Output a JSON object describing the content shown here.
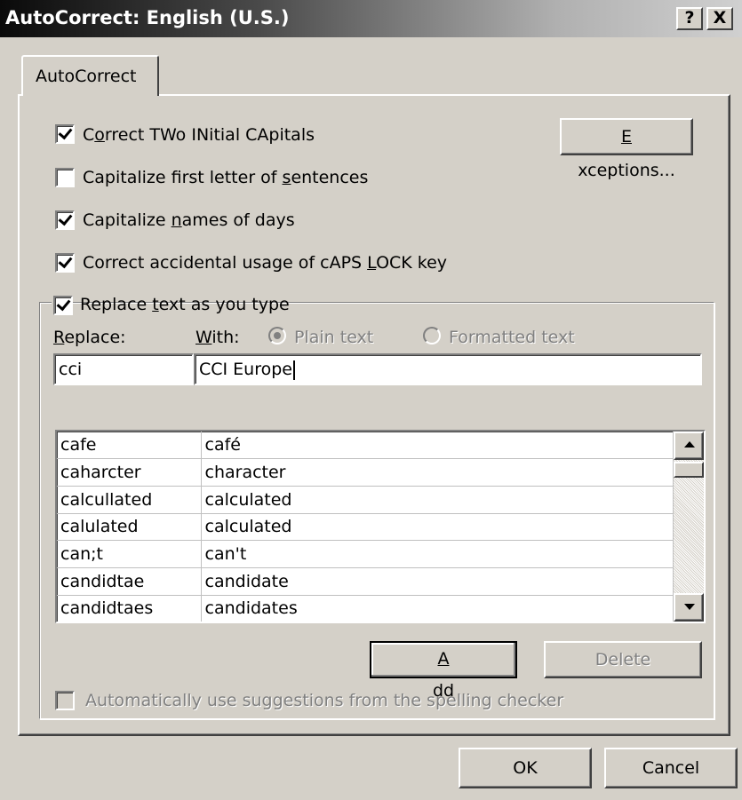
{
  "window": {
    "title": "AutoCorrect: English (U.S.)",
    "help_label": "?",
    "close_label": "X"
  },
  "tabs": [
    {
      "label": "AutoCorrect",
      "selected": true
    }
  ],
  "options": [
    {
      "pre": "C",
      "ul": "o",
      "post": "rrect TWo INitial CApitals",
      "checked": true,
      "enabled": true
    },
    {
      "pre": "Capitalize first letter of ",
      "ul": "s",
      "post": "entences",
      "checked": false,
      "enabled": true
    },
    {
      "pre": "Capitalize ",
      "ul": "n",
      "post": "ames of days",
      "checked": true,
      "enabled": true
    },
    {
      "pre": "Correct accidental usage of cAPS ",
      "ul": "L",
      "post": "OCK key",
      "checked": true,
      "enabled": true
    }
  ],
  "exceptions_button": {
    "ul": "E",
    "post": "xceptions..."
  },
  "replace_group": {
    "checkbox": {
      "pre": "Replace ",
      "ul": "t",
      "post": "ext as you type",
      "checked": true
    },
    "replace_label": {
      "ul": "R",
      "post": "eplace:"
    },
    "with_label": {
      "ul": "W",
      "post": "ith:"
    },
    "plain_text_label": "Plain text",
    "formatted_text_label": "Formatted text",
    "replace_value": "cci",
    "with_value": "CCI Europe"
  },
  "entries": [
    [
      "cafe",
      "café"
    ],
    [
      "caharcter",
      "character"
    ],
    [
      "calcullated",
      "calculated"
    ],
    [
      "calulated",
      "calculated"
    ],
    [
      "can;t",
      "can't"
    ],
    [
      "candidtae",
      "candidate"
    ],
    [
      "candidtaes",
      "candidates"
    ]
  ],
  "add_button": {
    "ul": "A",
    "post": "dd"
  },
  "delete_button": "Delete",
  "spelling_option": {
    "label": "Automatically use suggestions from the spelling checker",
    "checked": false,
    "enabled": false
  },
  "ok_button": "OK",
  "cancel_button": "Cancel",
  "colors": {
    "face": "#d4d0c8",
    "shadow": "#808080",
    "title_start": "#0a0a0a"
  }
}
